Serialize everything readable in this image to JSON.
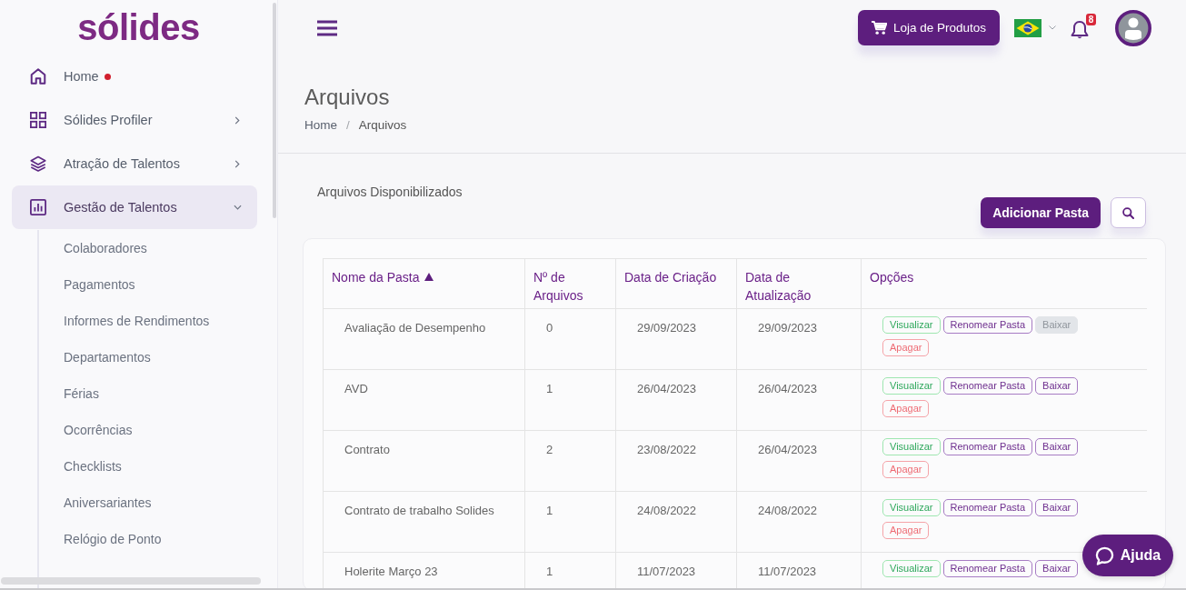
{
  "sidebar": {
    "logo": "sólides",
    "items": [
      {
        "label": "Home",
        "kind": "link",
        "unread": true,
        "selected": false
      },
      {
        "label": "Sólides Profiler",
        "kind": "group",
        "unread": false,
        "selected": false,
        "expanded": false
      },
      {
        "label": "Atração de Talentos",
        "kind": "group",
        "unread": false,
        "selected": false,
        "expanded": false
      },
      {
        "label": "Gestão de Talentos",
        "kind": "group",
        "unread": false,
        "selected": true,
        "expanded": true,
        "children": [
          {
            "label": "Colaboradores",
            "selected": false
          },
          {
            "label": "Pagamentos",
            "selected": false
          },
          {
            "label": "Informes de Rendimentos",
            "selected": false
          },
          {
            "label": "Departamentos",
            "selected": false
          },
          {
            "label": "Férias",
            "selected": false
          },
          {
            "label": "Ocorrências",
            "selected": false
          },
          {
            "label": "Checklists",
            "selected": false
          },
          {
            "label": "Aniversariantes",
            "selected": false
          },
          {
            "label": "Relógio de Ponto",
            "selected": false
          }
        ]
      }
    ]
  },
  "topbar": {
    "store_button": "Loja de Produtos",
    "notifications": {
      "count": "8"
    }
  },
  "page": {
    "title": "Arquivos",
    "breadcrumb": {
      "items": [
        "Home",
        "Arquivos"
      ],
      "separator": "/"
    }
  },
  "files": {
    "title": "Arquivos Disponibilizados",
    "add_button": "Adicionar Pasta",
    "table": {
      "columns": [
        {
          "label": "Nome da Pasta",
          "sorted": true
        },
        {
          "label": "Nº de Arquivos",
          "sorted": false
        },
        {
          "label": "Data de Criação",
          "sorted": false
        },
        {
          "label": "Data de Atualização",
          "sorted": false
        },
        {
          "label": "Opções",
          "sorted": false
        }
      ],
      "rows": [
        {
          "name": "Avaliação de Desempenho",
          "files": "0",
          "created": "29/09/2023",
          "updated": "29/09/2023",
          "actions": [
            {
              "label": "Visualizar",
              "kind": "view",
              "disabled": false
            },
            {
              "label": "Renomear Pasta",
              "kind": "rename",
              "disabled": false
            },
            {
              "label": "Baixar",
              "kind": "download",
              "disabled": true
            },
            {
              "label": "Apagar",
              "kind": "delete",
              "disabled": false
            }
          ]
        },
        {
          "name": "AVD",
          "files": "1",
          "created": "26/04/2023",
          "updated": "26/04/2023",
          "actions": [
            {
              "label": "Visualizar",
              "kind": "view",
              "disabled": false
            },
            {
              "label": "Renomear Pasta",
              "kind": "rename",
              "disabled": false
            },
            {
              "label": "Baixar",
              "kind": "download",
              "disabled": false
            },
            {
              "label": "Apagar",
              "kind": "delete",
              "disabled": false
            }
          ]
        },
        {
          "name": "Contrato",
          "files": "2",
          "created": "23/08/2022",
          "updated": "26/04/2023",
          "actions": [
            {
              "label": "Visualizar",
              "kind": "view",
              "disabled": false
            },
            {
              "label": "Renomear Pasta",
              "kind": "rename",
              "disabled": false
            },
            {
              "label": "Baixar",
              "kind": "download",
              "disabled": false
            },
            {
              "label": "Apagar",
              "kind": "delete",
              "disabled": false
            }
          ]
        },
        {
          "name": "Contrato de trabalho Solides",
          "files": "1",
          "created": "24/08/2022",
          "updated": "24/08/2022",
          "actions": [
            {
              "label": "Visualizar",
              "kind": "view",
              "disabled": false
            },
            {
              "label": "Renomear Pasta",
              "kind": "rename",
              "disabled": false
            },
            {
              "label": "Baixar",
              "kind": "download",
              "disabled": false
            },
            {
              "label": "Apagar",
              "kind": "delete",
              "disabled": false
            }
          ]
        },
        {
          "name": "Holerite Março 23",
          "files": "1",
          "created": "11/07/2023",
          "updated": "11/07/2023",
          "actions": [
            {
              "label": "Visualizar",
              "kind": "view",
              "disabled": false
            },
            {
              "label": "Renomear Pasta",
              "kind": "rename",
              "disabled": false
            },
            {
              "label": "Baixar",
              "kind": "download",
              "disabled": false
            }
          ]
        }
      ]
    }
  },
  "help_button": "Ajuda"
}
